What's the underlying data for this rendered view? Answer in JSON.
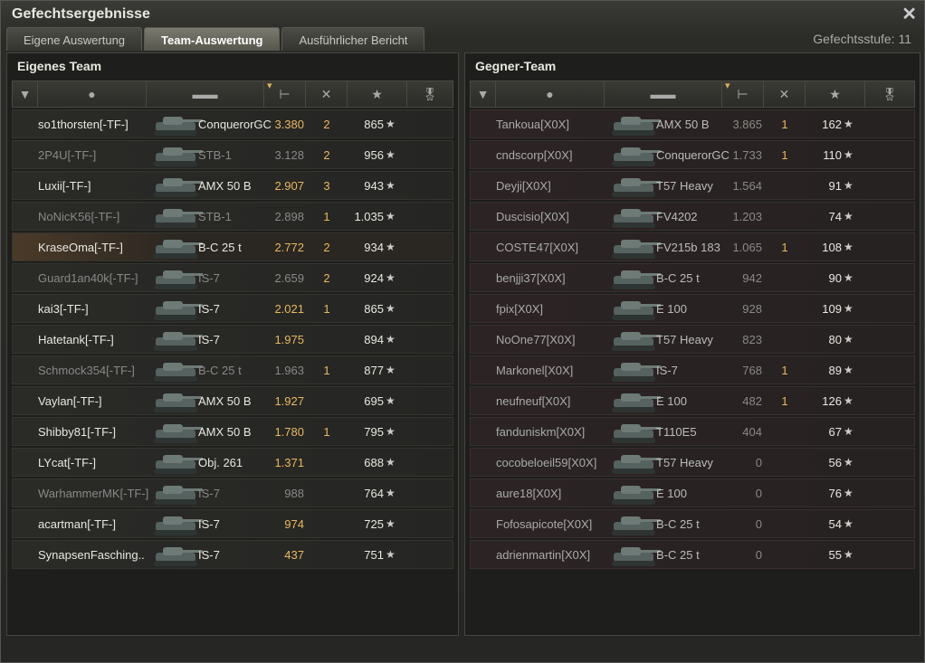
{
  "window": {
    "title": "Gefechtsergebnisse",
    "close_icon": "close-icon"
  },
  "tabs": [
    {
      "label": "Eigene Auswertung",
      "active": false
    },
    {
      "label": "Team-Auswertung",
      "active": true
    },
    {
      "label": "Ausführlicher Bericht",
      "active": false
    }
  ],
  "battle_level": "Gefechtsstufe: 11",
  "header_icons": [
    "rank-icon",
    "player-icon",
    "tank-icon",
    "damage-icon",
    "destroyed-icon",
    "xp-star-icon",
    "medal-icon"
  ],
  "own_team": {
    "title": "Eigenes Team",
    "players": [
      {
        "name": "so1thorsten[-TF-]",
        "tank": "ConquerorGC",
        "damage": "3.380",
        "kills": "2",
        "xp": "865",
        "alive": true,
        "self": false
      },
      {
        "name": "2P4U[-TF-]",
        "tank": "STB-1",
        "damage": "3.128",
        "kills": "2",
        "xp": "956",
        "alive": false,
        "self": false
      },
      {
        "name": "Luxii[-TF-]",
        "tank": "AMX 50 B",
        "damage": "2.907",
        "kills": "3",
        "xp": "943",
        "alive": true,
        "self": false
      },
      {
        "name": "NoNicK56[-TF-]",
        "tank": "STB-1",
        "damage": "2.898",
        "kills": "1",
        "xp": "1.035",
        "alive": false,
        "self": false
      },
      {
        "name": "KraseOma[-TF-]",
        "tank": "B-C 25 t",
        "damage": "2.772",
        "kills": "2",
        "xp": "934",
        "alive": true,
        "self": true
      },
      {
        "name": "Guard1an40k[-TF-]",
        "tank": "IS-7",
        "damage": "2.659",
        "kills": "2",
        "xp": "924",
        "alive": false,
        "self": false
      },
      {
        "name": "kai3[-TF-]",
        "tank": "IS-7",
        "damage": "2.021",
        "kills": "1",
        "xp": "865",
        "alive": true,
        "self": false
      },
      {
        "name": "Hatetank[-TF-]",
        "tank": "IS-7",
        "damage": "1.975",
        "kills": "",
        "xp": "894",
        "alive": true,
        "self": false
      },
      {
        "name": "Schmock354[-TF-]",
        "tank": "B-C 25 t",
        "damage": "1.963",
        "kills": "1",
        "xp": "877",
        "alive": false,
        "self": false
      },
      {
        "name": "Vaylan[-TF-]",
        "tank": "AMX 50 B",
        "damage": "1.927",
        "kills": "",
        "xp": "695",
        "alive": true,
        "self": false
      },
      {
        "name": "Shibby81[-TF-]",
        "tank": "AMX 50 B",
        "damage": "1.780",
        "kills": "1",
        "xp": "795",
        "alive": true,
        "self": false
      },
      {
        "name": "LYcat[-TF-]",
        "tank": "Obj. 261",
        "damage": "1.371",
        "kills": "",
        "xp": "688",
        "alive": true,
        "self": false
      },
      {
        "name": "WarhammerMK[-TF-]",
        "tank": "IS-7",
        "damage": "988",
        "kills": "",
        "xp": "764",
        "alive": false,
        "self": false
      },
      {
        "name": "acartman[-TF-]",
        "tank": "IS-7",
        "damage": "974",
        "kills": "",
        "xp": "725",
        "alive": true,
        "self": false
      },
      {
        "name": "SynapsenFasching..",
        "tank": "IS-7",
        "damage": "437",
        "kills": "",
        "xp": "751",
        "alive": true,
        "self": false
      }
    ]
  },
  "enemy_team": {
    "title": "Gegner-Team",
    "players": [
      {
        "name": "Tankoua[X0X]",
        "tank": "AMX 50 B",
        "damage": "3.865",
        "kills": "1",
        "xp": "162"
      },
      {
        "name": "cndscorp[X0X]",
        "tank": "ConquerorGC",
        "damage": "1.733",
        "kills": "1",
        "xp": "110"
      },
      {
        "name": "Deyji[X0X]",
        "tank": "T57 Heavy",
        "damage": "1.564",
        "kills": "",
        "xp": "91"
      },
      {
        "name": "Duscisio[X0X]",
        "tank": "FV4202",
        "damage": "1.203",
        "kills": "",
        "xp": "74"
      },
      {
        "name": "COSTE47[X0X]",
        "tank": "FV215b 183",
        "damage": "1.065",
        "kills": "1",
        "xp": "108"
      },
      {
        "name": "benjji37[X0X]",
        "tank": "B-C 25 t",
        "damage": "942",
        "kills": "",
        "xp": "90"
      },
      {
        "name": "fpix[X0X]",
        "tank": "E 100",
        "damage": "928",
        "kills": "",
        "xp": "109"
      },
      {
        "name": "NoOne77[X0X]",
        "tank": "T57 Heavy",
        "damage": "823",
        "kills": "",
        "xp": "80"
      },
      {
        "name": "Markonel[X0X]",
        "tank": "IS-7",
        "damage": "768",
        "kills": "1",
        "xp": "89"
      },
      {
        "name": "neufneuf[X0X]",
        "tank": "E 100",
        "damage": "482",
        "kills": "1",
        "xp": "126"
      },
      {
        "name": "fanduniskm[X0X]",
        "tank": "T110E5",
        "damage": "404",
        "kills": "",
        "xp": "67"
      },
      {
        "name": "cocobeloeil59[X0X]",
        "tank": "T57 Heavy",
        "damage": "0",
        "kills": "",
        "xp": "56"
      },
      {
        "name": "aure18[X0X]",
        "tank": "E 100",
        "damage": "0",
        "kills": "",
        "xp": "76"
      },
      {
        "name": "Fofosapicote[X0X]",
        "tank": "B-C 25 t",
        "damage": "0",
        "kills": "",
        "xp": "54"
      },
      {
        "name": "adrienmartin[X0X]",
        "tank": "B-C 25 t",
        "damage": "0",
        "kills": "",
        "xp": "55"
      }
    ]
  },
  "colors": {
    "damage": "#e8b860",
    "self_row": "#4a3a28",
    "enemy_row": "#2c2324"
  }
}
